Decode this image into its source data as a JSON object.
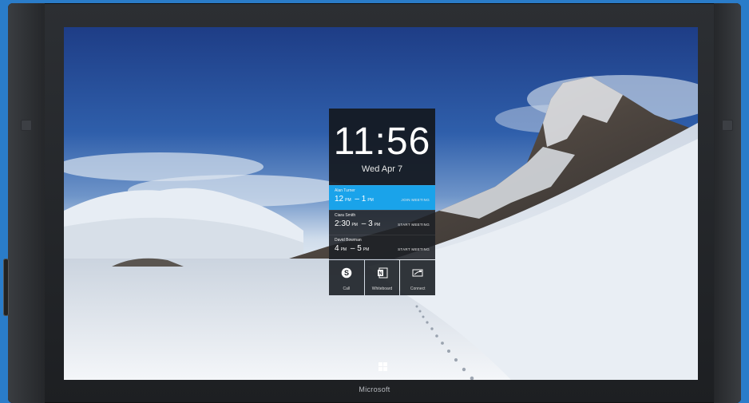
{
  "device": {
    "brand": "Microsoft"
  },
  "lock_screen": {
    "time": "11:56",
    "date": "Wed Apr 7",
    "meetings": [
      {
        "name": "Alan Turner",
        "start": "12",
        "start_suffix": "PM",
        "end": "1",
        "end_suffix": "PM",
        "action": "JOIN MEETING",
        "active": true
      },
      {
        "name": "Ciara Smith",
        "start": "2:30",
        "start_suffix": "PM",
        "end": "3",
        "end_suffix": "PM",
        "action": "START MEETING",
        "active": false
      },
      {
        "name": "David Bowman",
        "start": "4",
        "start_suffix": "PM",
        "end": "5",
        "end_suffix": "PM",
        "action": "START MEETING",
        "active": false
      }
    ],
    "tiles": [
      {
        "label": "Call",
        "icon": "skype-icon"
      },
      {
        "label": "Whiteboard",
        "icon": "onenote-icon"
      },
      {
        "label": "Connect",
        "icon": "connect-icon"
      }
    ]
  },
  "colors": {
    "accent": "#1aa3ea",
    "bezel": "#25272a",
    "frame": "#2a7cc9"
  }
}
